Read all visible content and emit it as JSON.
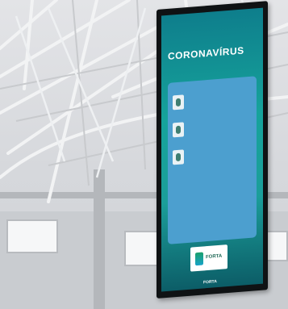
{
  "sign": {
    "headline": "CORONAVÍRUS",
    "subline": "",
    "tagline": "",
    "tips": [
      "",
      "",
      "",
      ""
    ],
    "closing": "",
    "logo_text": "FORTA",
    "footer_logo": "FORTA"
  },
  "colors": {
    "screen_top": "#0e7e8c",
    "screen_bottom": "#0c5d67",
    "panel": "#4c9fcf",
    "sign_frame": "#0f1214"
  },
  "icons": [
    "roof-truss-icon",
    "hand-wash-icon",
    "mask-icon",
    "distance-icon",
    "forta-logo-icon"
  ]
}
